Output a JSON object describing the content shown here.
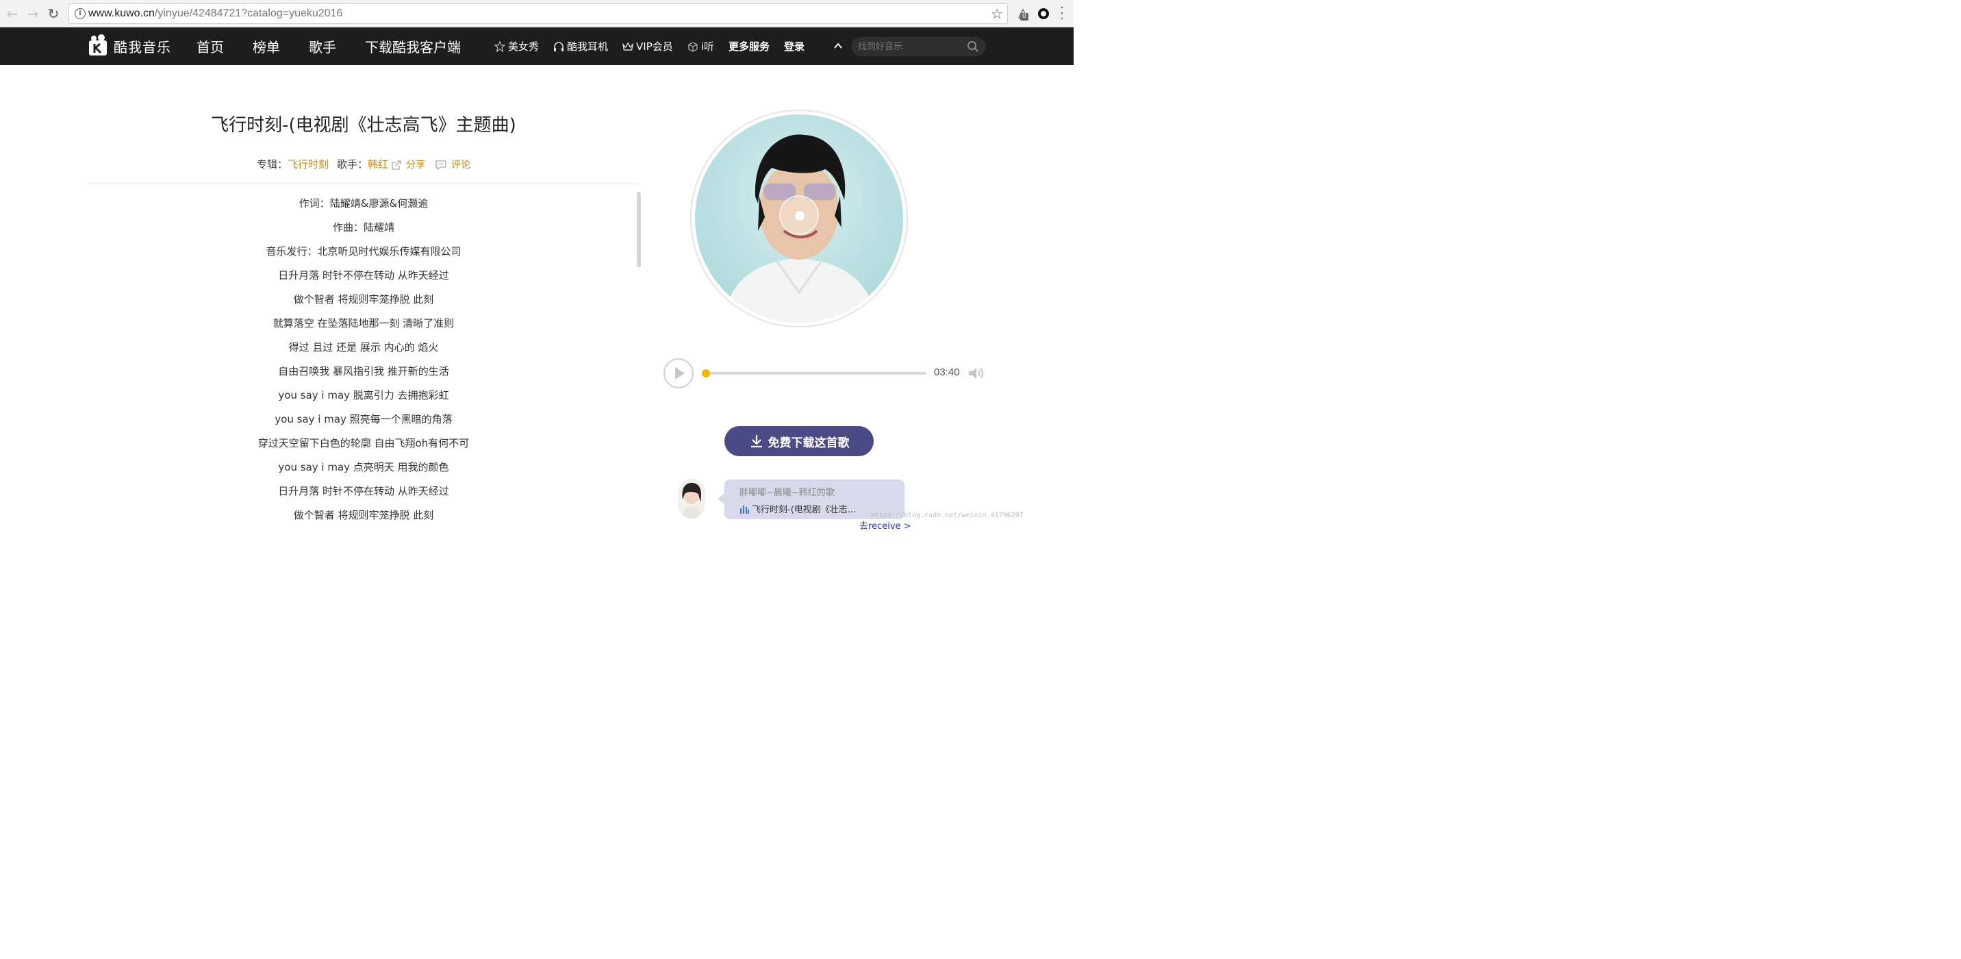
{
  "browser": {
    "url_host": "www.kuwo.cn",
    "url_path": "/yinyue/42484721?catalog=yueku2016",
    "extension_badge": "0"
  },
  "header": {
    "logo_text": "酷我音乐",
    "main_nav": [
      "首页",
      "榜单",
      "歌手",
      "下载酷我客户端"
    ],
    "sub_nav": {
      "beauty": "美女秀",
      "headphones": "酷我耳机",
      "vip": "VIP会员",
      "ilisten": "i听",
      "more": "更多服务",
      "login": "登录"
    },
    "search_placeholder": "找到好音乐"
  },
  "song": {
    "title": "飞行时刻-(电视剧《壮志高飞》主题曲)",
    "album_label": "专辑：",
    "album": "飞行时刻",
    "artist_label": "歌手：",
    "artist": "韩红",
    "share": "分享",
    "comment": "评论"
  },
  "lyrics": [
    "作词：陆耀靖&廖源&何灏逾",
    "作曲：陆耀靖",
    "音乐发行：北京听见时代娱乐传媒有限公司",
    "日升月落 时针不停在转动 从昨天经过",
    "做个智者 将规则牢笼挣脱 此刻",
    "就算落空 在坠落陆地那一刻 清晰了准则",
    "得过 且过 还是 展示 内心的 焰火",
    "自由召唤我 暴风指引我 推开新的生活",
    "you say i may 脱离引力 去拥抱彩虹",
    "you say i may 照亮每一个黑暗的角落",
    "穿过天空留下白色的轮廓 自由飞翔oh有何不可",
    "you say i may 点亮明天 用我的颜色",
    "日升月落 时针不停在转动 从昨天经过",
    "做个智者 将规则牢笼挣脱 此刻"
  ],
  "player": {
    "duration": "03:40",
    "progress": 0.0
  },
  "download": {
    "label": "免费下载这首歌"
  },
  "feed": {
    "user_line": "胖嘟嘟~晨曦~韩红的歌",
    "song_line": "飞行时刻-(电视剧《壮志...",
    "more_link": "去receive >"
  },
  "watermark": "https://blog.csdn.net/weixin_41796207",
  "colors": {
    "header_bg": "#1d1d1d",
    "link_gold": "#c18a18",
    "progress": "#f5b400",
    "download_btn": "#4a4a85",
    "bubble_bg": "#d9d9ec"
  }
}
